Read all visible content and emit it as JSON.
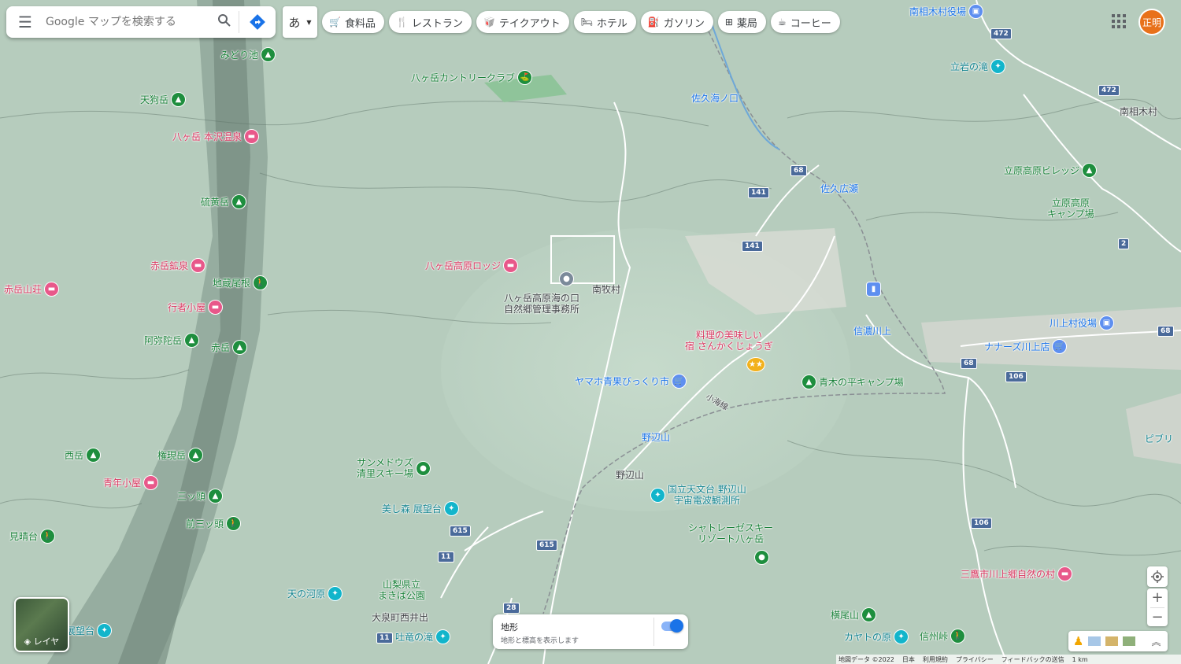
{
  "search": {
    "placeholder": "Google マップを検索する"
  },
  "ime": {
    "label": "あ"
  },
  "chips": [
    {
      "label": "食料品",
      "icon": "cart-icon"
    },
    {
      "label": "レストラン",
      "icon": "fork-knife-icon"
    },
    {
      "label": "テイクアウト",
      "icon": "takeout-icon"
    },
    {
      "label": "ホテル",
      "icon": "bed-icon"
    },
    {
      "label": "ガソリン",
      "icon": "fuel-icon"
    },
    {
      "label": "薬局",
      "icon": "pharmacy-icon"
    },
    {
      "label": "コーヒー",
      "icon": "coffee-icon"
    }
  ],
  "account": {
    "avatar_text": "正明"
  },
  "layers": {
    "label": "レイヤ"
  },
  "terrain": {
    "title": "地形",
    "description": "地形と標高を表示します",
    "enabled": true
  },
  "footer": {
    "items": [
      "地図データ ©2022",
      "日本",
      "利用規約",
      "プライバシー",
      "フィードバックの送信",
      "1 km"
    ]
  },
  "colors": {
    "park": "#188038",
    "lodging": "#d93760",
    "attraction": "#12838e",
    "shop": "#1a73e8",
    "avatar": "#e8711a"
  },
  "places": {
    "midori_ike": "みどり池",
    "yatsugatake_cc": "八ヶ岳カントリークラブ",
    "tengudake": "天狗岳",
    "honzawa": "八ヶ岳 本沢温泉",
    "iodake": "硫黄岳",
    "akadake_kosen": "赤岳鉱泉",
    "akadake_sanso": "赤岳山荘",
    "jizou_one": "地蔵尾根",
    "gyoja_goya": "行者小屋",
    "amidadake": "阿弥陀岳",
    "akadake": "赤岳",
    "nishidake": "西岳",
    "gongendake": "権現岳",
    "seinen_goya": "青年小屋",
    "mitsugashira": "三ッ頭",
    "mae_mitsugashira": "前三ッ頭",
    "miharashi": "見晴台",
    "kogen_lodge": "八ヶ岳高原ロッジ",
    "shizen_office_1": "八ヶ岳高原海の口",
    "shizen_office_2": "自然郷管理事務所",
    "minamimaki": "南牧村",
    "ryori_1": "料理の美味しい",
    "ryori_2": "宿 さんかくじょうぎ",
    "yamaho": "ヤマホ青果びっくり市",
    "aokinodaira": "青木の平キャンプ場",
    "nobeyama_st": "野辺山",
    "nobeyama": "野辺山",
    "sunmeadows_1": "サンメドウズ",
    "sunmeadows_2": "清里スキー場",
    "utsukushimori": "美し森 展望台",
    "tenmondai_1": "国立天文台 野辺山",
    "tenmondai_2": "宇宙電波観測所",
    "chateraise_1": "シャトレーゼスキー",
    "chateraise_2": "リゾート八ヶ岳",
    "tennokawara": "天の河原",
    "makiba_1": "山梨県立",
    "makiba_2": "まきば公園",
    "nishiide": "大泉町西井出",
    "fukiryu": "吐竜の滝",
    "tenbodai": "展望台",
    "sakuuminokuchi": "佐久海ノ口",
    "sakuhiroseh": "佐久広瀬",
    "minamiaiki_office": "南相木村役場",
    "tateiwa": "立岩の滝",
    "minamiaiki": "南相木村",
    "tachiwara_village": "立原高原ビレッジ",
    "tachiwara_camp_1": "立原高原",
    "tachiwara_camp_2": "キャンプ場",
    "shinano_kawakami": "信濃川上",
    "kawakami_office": "川上村役場",
    "nanasu": "ナナーズ川上店",
    "mitaka": "三鷹市川上郷自然の村",
    "yokoodake": "横尾山",
    "kayato": "カヤトの原",
    "shinshu_toge": "信州峠",
    "piburi": "ピブリ"
  },
  "routes": {
    "r472a": "472",
    "r472b": "472",
    "r68a": "68",
    "r68b": "68",
    "r68c": "68",
    "r141a": "141",
    "r141b": "141",
    "r106a": "106",
    "r106b": "106",
    "r2": "2",
    "r615a": "615",
    "r615b": "615",
    "r11a": "11",
    "r11b": "11",
    "r28": "28",
    "line": "小海線"
  }
}
